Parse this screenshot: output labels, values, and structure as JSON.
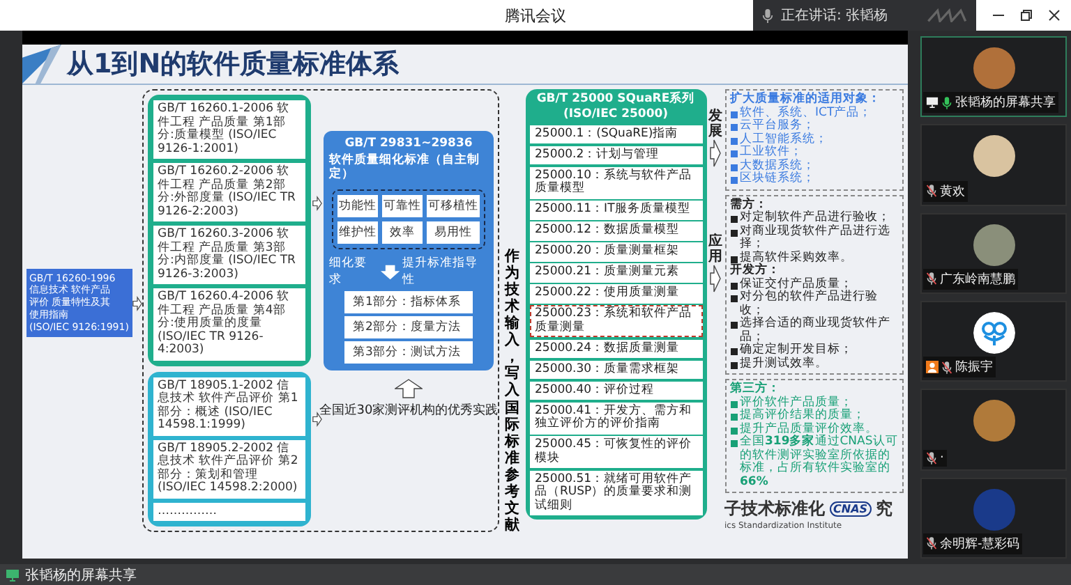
{
  "window": {
    "title": "腾讯会议"
  },
  "speaker": {
    "label": "正在讲话: 张韬杨"
  },
  "slide": {
    "title": "从1到N的软件质量标准体系",
    "origin": [
      "GB/T 16260-1996",
      "信息技术 软件产品",
      "评价 质量特性及其",
      "使用指南",
      "(ISO/IEC 9126:1991)"
    ],
    "groups": [
      {
        "kind": "quality",
        "items": [
          "GB/T 16260.1-2006 软件工程 产品质量 第1部分:质量模型 (ISO/IEC 9126-1:2001)",
          "GB/T 16260.2-2006 软件工程 产品质量 第2部分:外部度量 (ISO/IEC TR 9126-2:2003)",
          "GB/T 16260.3-2006 软件工程 产品质量 第3部分:内部度量 (ISO/IEC TR 9126-3:2003)",
          "GB/T 16260.4-2006 软件工程 产品质量 第4部分:使用质量的度量 (ISO/IEC TR 9126-4:2003)"
        ]
      },
      {
        "kind": "evaluation",
        "items": [
          "GB/T 18905.1-2002 信息技术 软件产品评价 第1部分：概述 (ISO/IEC 14598.1:1999)",
          "GB/T 18905.2-2002 信息技术 软件产品评价 第2部分：策划和管理 (ISO/IEC 14598.2:2000)",
          "……………"
        ]
      }
    ],
    "refinement": {
      "title": "GB/T 29831~29836",
      "subtitle": "软件质量细化标准（自主制定）",
      "traits": [
        "功能性",
        "可靠性",
        "可移植性",
        "维护性",
        "效率",
        "易用性"
      ],
      "left_label": "细化要求",
      "right_label": "提升标准指导性",
      "parts": [
        "第1部分：指标体系",
        "第2部分：度量方法",
        "第3部分：测试方法"
      ]
    },
    "practice": "全国近30家测评机构的优秀实践",
    "input_note": "作为技术输入，写入国际标准参考文献",
    "square": {
      "title": "GB/T 25000 SQuaRE系列",
      "subtitle": "(ISO/IEC 25000)",
      "items": [
        {
          "text": "25000.1：(SQuaRE)指南",
          "selected": false
        },
        {
          "text": "25000.2：计划与管理",
          "selected": false
        },
        {
          "text": "25000.10：系统与软件产品质量模型",
          "selected": false
        },
        {
          "text": "25000.11：IT服务质量模型",
          "selected": false
        },
        {
          "text": "25000.12：数据质量模型",
          "selected": false
        },
        {
          "text": "25000.20：质量测量框架",
          "selected": false
        },
        {
          "text": "25000.21：质量测量元素",
          "selected": false
        },
        {
          "text": "25000.22：使用质量测量",
          "selected": false
        },
        {
          "text": "25000.23：系统和软件产品质量测量",
          "selected": true
        },
        {
          "text": "25000.24：数据质量测量",
          "selected": false
        },
        {
          "text": "25000.30：质量需求框架",
          "selected": false
        },
        {
          "text": "25000.40：评价过程",
          "selected": false
        },
        {
          "text": "25000.41：开发方、需方和独立评价方的评价指南",
          "selected": false
        },
        {
          "text": "25000.45：可恢复性的评价模块",
          "selected": false
        },
        {
          "text": "25000.51：就绪可用软件产品（RUSP）的质量要求和测试细则",
          "selected": false
        }
      ]
    },
    "flows": [
      {
        "label": "发展"
      },
      {
        "label": "应用"
      }
    ],
    "notes": [
      {
        "kind": "scope",
        "sections": [
          {
            "heading": "扩大质量标准的适用对象：",
            "bullets": [
              "软件、系统、ICT产品；",
              "云平台服务；",
              "人工智能系统；",
              "工业软件；",
              "大数据系统；",
              "区块链系统；"
            ]
          }
        ]
      },
      {
        "kind": "roles",
        "sections": [
          {
            "heading": "需方：",
            "bullets": [
              "对定制软件产品进行验收；",
              "对商业现货软件产品进行选择；",
              "提高软件采购效率。"
            ]
          },
          {
            "heading": "开发方：",
            "bullets": [
              "保证交付产品质量；",
              "对分包的软件产品进行验收；",
              "选择合适的商业现货软件产品；",
              "确定定制开发目标；",
              "提升测试效率。"
            ]
          }
        ]
      },
      {
        "kind": "third",
        "sections": [
          {
            "heading": "第三方：",
            "bullets": [
              "评价软件产品质量；",
              "提高评价结果的质量；",
              "提升产品质量评价效率。",
              "全国**319多家**通过CNAS认可的软件测评实验室所依据的标准，占所有软件实验室的**66%**"
            ]
          }
        ]
      }
    ],
    "footer": {
      "name": "子技术标准化",
      "badge": "CNAS",
      "tail": "究",
      "english": "ics Standardization Institute"
    }
  },
  "participants": [
    {
      "name": "张韬杨的屏幕共享",
      "kind": "photo",
      "color": "#b0703a",
      "muted": false,
      "sharing": true,
      "host": false,
      "speaking": true
    },
    {
      "name": "黄欢",
      "kind": "photo",
      "color": "#d9c3a0",
      "muted": true,
      "sharing": false,
      "host": false,
      "speaking": false
    },
    {
      "name": "广东岭南慧鹏",
      "kind": "photo",
      "color": "#8a8f7a",
      "muted": true,
      "sharing": false,
      "host": false,
      "speaking": false
    },
    {
      "name": "陈振宇",
      "kind": "logo",
      "color": "#ffffff",
      "muted": true,
      "sharing": false,
      "host": true,
      "speaking": false
    },
    {
      "name": "·",
      "kind": "photo",
      "color": "#b07a3a",
      "muted": true,
      "sharing": false,
      "host": false,
      "speaking": false
    },
    {
      "name": "余明辉-慧彩码",
      "kind": "photo",
      "color": "#1a3a8a",
      "muted": true,
      "sharing": false,
      "host": false,
      "speaking": false
    }
  ],
  "share_bar": {
    "label": "张韬杨的屏幕共享"
  }
}
